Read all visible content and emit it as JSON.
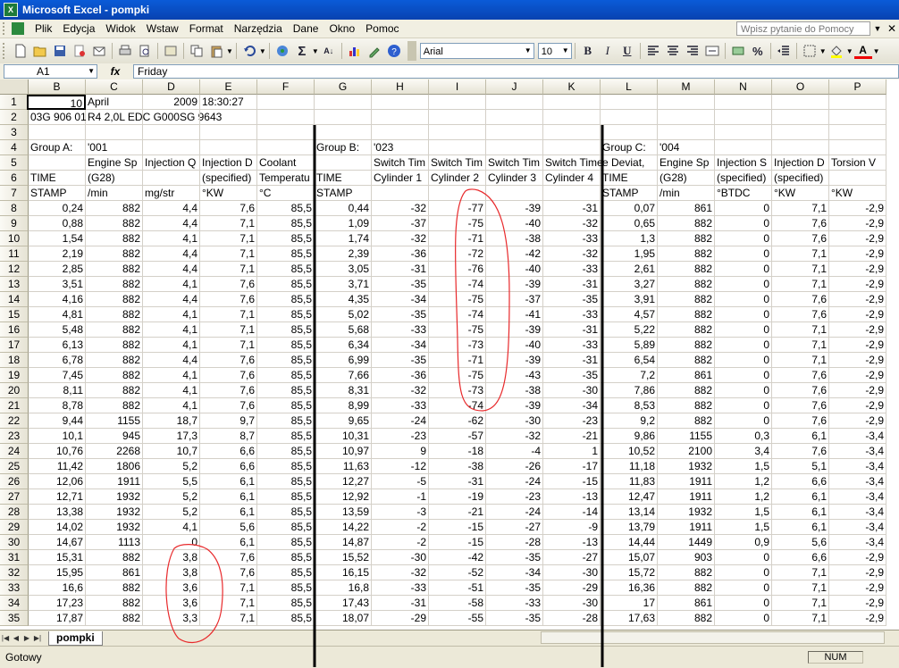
{
  "window": {
    "title": "Microsoft Excel - pompki",
    "app_icon": "excel-icon"
  },
  "menu": {
    "items": [
      "Plik",
      "Edycja",
      "Widok",
      "Wstaw",
      "Format",
      "Narzędzia",
      "Dane",
      "Okno",
      "Pomoc"
    ],
    "help_placeholder": "Wpisz pytanie do Pomocy"
  },
  "toolbar": {
    "font": "Arial",
    "font_size": "10"
  },
  "formula_bar": {
    "name_box": "A1",
    "fx_label": "fx",
    "value": "Friday"
  },
  "columns": [
    "B",
    "C",
    "D",
    "E",
    "F",
    "G",
    "H",
    "I",
    "J",
    "K",
    "L",
    "M",
    "N",
    "O",
    "P"
  ],
  "grid": [
    {
      "row": "1",
      "cells": [
        "10",
        "April",
        "2009",
        "18:30:27",
        "",
        "",
        "",
        "",
        "",
        "",
        "",
        "",
        "",
        "",
        ""
      ]
    },
    {
      "row": "2",
      "cells": [
        "03G 906 01",
        "R4 2,0L EDC G000SG  9643",
        "",
        "",
        "",
        "",
        "",
        "",
        "",
        "",
        "",
        "",
        "",
        "",
        ""
      ]
    },
    {
      "row": "3",
      "cells": [
        "",
        "",
        "",
        "",
        "",
        "",
        "",
        "",
        "",
        "",
        "",
        "",
        "",
        "",
        ""
      ]
    },
    {
      "row": "4",
      "cells": [
        "Group A:",
        "'001",
        "",
        "",
        "",
        "Group B:",
        "'023",
        "",
        "",
        "",
        "Group C:",
        "'004",
        "",
        "",
        ""
      ]
    },
    {
      "row": "5",
      "cells": [
        "",
        "Engine Sp",
        "Injection Q",
        "Injection D",
        "Coolant",
        "",
        "Switch Tim",
        "Switch Tim",
        "Switch Tim",
        "Switch Time",
        "e Deviat,",
        "Engine Sp",
        "Injection S",
        "Injection D",
        "Torsion V"
      ]
    },
    {
      "row": "6",
      "cells": [
        "TIME",
        "(G28)",
        "",
        "(specified)",
        "Temperatu",
        "TIME",
        "Cylinder 1",
        "Cylinder 2",
        "Cylinder 3",
        "Cylinder 4",
        "TIME",
        "(G28)",
        "(specified)",
        "(specified)",
        ""
      ]
    },
    {
      "row": "7",
      "cells": [
        "STAMP",
        "/min",
        "mg/str",
        "°KW",
        "°C",
        "STAMP",
        "",
        "",
        "",
        "",
        "STAMP",
        "/min",
        "°BTDC",
        "°KW",
        "°KW"
      ]
    },
    {
      "row": "8",
      "cells": [
        "0,24",
        "882",
        "4,4",
        "7,6",
        "85,5",
        "0,44",
        "-32",
        "-77",
        "-39",
        "-31",
        "0,07",
        "861",
        "0",
        "7,1",
        "-2,9"
      ]
    },
    {
      "row": "9",
      "cells": [
        "0,88",
        "882",
        "4,4",
        "7,1",
        "85,5",
        "1,09",
        "-37",
        "-75",
        "-40",
        "-32",
        "0,65",
        "882",
        "0",
        "7,6",
        "-2,9"
      ]
    },
    {
      "row": "10",
      "cells": [
        "1,54",
        "882",
        "4,1",
        "7,1",
        "85,5",
        "1,74",
        "-32",
        "-71",
        "-38",
        "-33",
        "1,3",
        "882",
        "0",
        "7,6",
        "-2,9"
      ]
    },
    {
      "row": "11",
      "cells": [
        "2,19",
        "882",
        "4,4",
        "7,1",
        "85,5",
        "2,39",
        "-36",
        "-72",
        "-42",
        "-32",
        "1,95",
        "882",
        "0",
        "7,1",
        "-2,9"
      ]
    },
    {
      "row": "12",
      "cells": [
        "2,85",
        "882",
        "4,4",
        "7,1",
        "85,5",
        "3,05",
        "-31",
        "-76",
        "-40",
        "-33",
        "2,61",
        "882",
        "0",
        "7,1",
        "-2,9"
      ]
    },
    {
      "row": "13",
      "cells": [
        "3,51",
        "882",
        "4,1",
        "7,6",
        "85,5",
        "3,71",
        "-35",
        "-74",
        "-39",
        "-31",
        "3,27",
        "882",
        "0",
        "7,1",
        "-2,9"
      ]
    },
    {
      "row": "14",
      "cells": [
        "4,16",
        "882",
        "4,4",
        "7,6",
        "85,5",
        "4,35",
        "-34",
        "-75",
        "-37",
        "-35",
        "3,91",
        "882",
        "0",
        "7,6",
        "-2,9"
      ]
    },
    {
      "row": "15",
      "cells": [
        "4,81",
        "882",
        "4,1",
        "7,1",
        "85,5",
        "5,02",
        "-35",
        "-74",
        "-41",
        "-33",
        "4,57",
        "882",
        "0",
        "7,6",
        "-2,9"
      ]
    },
    {
      "row": "16",
      "cells": [
        "5,48",
        "882",
        "4,1",
        "7,1",
        "85,5",
        "5,68",
        "-33",
        "-75",
        "-39",
        "-31",
        "5,22",
        "882",
        "0",
        "7,1",
        "-2,9"
      ]
    },
    {
      "row": "17",
      "cells": [
        "6,13",
        "882",
        "4,1",
        "7,1",
        "85,5",
        "6,34",
        "-34",
        "-73",
        "-40",
        "-33",
        "5,89",
        "882",
        "0",
        "7,1",
        "-2,9"
      ]
    },
    {
      "row": "18",
      "cells": [
        "6,78",
        "882",
        "4,4",
        "7,6",
        "85,5",
        "6,99",
        "-35",
        "-71",
        "-39",
        "-31",
        "6,54",
        "882",
        "0",
        "7,1",
        "-2,9"
      ]
    },
    {
      "row": "19",
      "cells": [
        "7,45",
        "882",
        "4,1",
        "7,6",
        "85,5",
        "7,66",
        "-36",
        "-75",
        "-43",
        "-35",
        "7,2",
        "861",
        "0",
        "7,6",
        "-2,9"
      ]
    },
    {
      "row": "20",
      "cells": [
        "8,11",
        "882",
        "4,1",
        "7,6",
        "85,5",
        "8,31",
        "-32",
        "-73",
        "-38",
        "-30",
        "7,86",
        "882",
        "0",
        "7,6",
        "-2,9"
      ]
    },
    {
      "row": "21",
      "cells": [
        "8,78",
        "882",
        "4,1",
        "7,6",
        "85,5",
        "8,99",
        "-33",
        "-74",
        "-39",
        "-34",
        "8,53",
        "882",
        "0",
        "7,6",
        "-2,9"
      ]
    },
    {
      "row": "22",
      "cells": [
        "9,44",
        "1155",
        "18,7",
        "9,7",
        "85,5",
        "9,65",
        "-24",
        "-62",
        "-30",
        "-23",
        "9,2",
        "882",
        "0",
        "7,6",
        "-2,9"
      ]
    },
    {
      "row": "23",
      "cells": [
        "10,1",
        "945",
        "17,3",
        "8,7",
        "85,5",
        "10,31",
        "-23",
        "-57",
        "-32",
        "-21",
        "9,86",
        "1155",
        "0,3",
        "6,1",
        "-3,4"
      ]
    },
    {
      "row": "24",
      "cells": [
        "10,76",
        "2268",
        "10,7",
        "6,6",
        "85,5",
        "10,97",
        "9",
        "-18",
        "-4",
        "1",
        "10,52",
        "2100",
        "3,4",
        "7,6",
        "-3,4"
      ]
    },
    {
      "row": "25",
      "cells": [
        "11,42",
        "1806",
        "5,2",
        "6,6",
        "85,5",
        "11,63",
        "-12",
        "-38",
        "-26",
        "-17",
        "11,18",
        "1932",
        "1,5",
        "5,1",
        "-3,4"
      ]
    },
    {
      "row": "26",
      "cells": [
        "12,06",
        "1911",
        "5,5",
        "6,1",
        "85,5",
        "12,27",
        "-5",
        "-31",
        "-24",
        "-15",
        "11,83",
        "1911",
        "1,2",
        "6,6",
        "-3,4"
      ]
    },
    {
      "row": "27",
      "cells": [
        "12,71",
        "1932",
        "5,2",
        "6,1",
        "85,5",
        "12,92",
        "-1",
        "-19",
        "-23",
        "-13",
        "12,47",
        "1911",
        "1,2",
        "6,1",
        "-3,4"
      ]
    },
    {
      "row": "28",
      "cells": [
        "13,38",
        "1932",
        "5,2",
        "6,1",
        "85,5",
        "13,59",
        "-3",
        "-21",
        "-24",
        "-14",
        "13,14",
        "1932",
        "1,5",
        "6,1",
        "-3,4"
      ]
    },
    {
      "row": "29",
      "cells": [
        "14,02",
        "1932",
        "4,1",
        "5,6",
        "85,5",
        "14,22",
        "-2",
        "-15",
        "-27",
        "-9",
        "13,79",
        "1911",
        "1,5",
        "6,1",
        "-3,4"
      ]
    },
    {
      "row": "30",
      "cells": [
        "14,67",
        "1113",
        "0",
        "6,1",
        "85,5",
        "14,87",
        "-2",
        "-15",
        "-28",
        "-13",
        "14,44",
        "1449",
        "0,9",
        "5,6",
        "-3,4"
      ]
    },
    {
      "row": "31",
      "cells": [
        "15,31",
        "882",
        "3,8",
        "7,6",
        "85,5",
        "15,52",
        "-30",
        "-42",
        "-35",
        "-27",
        "15,07",
        "903",
        "0",
        "6,6",
        "-2,9"
      ]
    },
    {
      "row": "32",
      "cells": [
        "15,95",
        "861",
        "3,8",
        "7,6",
        "85,5",
        "16,15",
        "-32",
        "-52",
        "-34",
        "-30",
        "15,72",
        "882",
        "0",
        "7,1",
        "-2,9"
      ]
    },
    {
      "row": "33",
      "cells": [
        "16,6",
        "882",
        "3,6",
        "7,1",
        "85,5",
        "16,8",
        "-33",
        "-51",
        "-35",
        "-29",
        "16,36",
        "882",
        "0",
        "7,1",
        "-2,9"
      ]
    },
    {
      "row": "34",
      "cells": [
        "17,23",
        "882",
        "3,6",
        "7,1",
        "85,5",
        "17,43",
        "-31",
        "-58",
        "-33",
        "-30",
        "17",
        "861",
        "0",
        "7,1",
        "-2,9"
      ]
    },
    {
      "row": "35",
      "cells": [
        "17,87",
        "882",
        "3,3",
        "7,1",
        "85,5",
        "18,07",
        "-29",
        "-55",
        "-35",
        "-28",
        "17,63",
        "882",
        "0",
        "7,1",
        "-2,9"
      ]
    }
  ],
  "sheet_tab": "pompki",
  "status": {
    "text": "Gotowy",
    "num": "NUM"
  },
  "colors": {
    "title_bar": "#0a5bd8",
    "annotation": "#e8292b",
    "separator": "#000000"
  }
}
